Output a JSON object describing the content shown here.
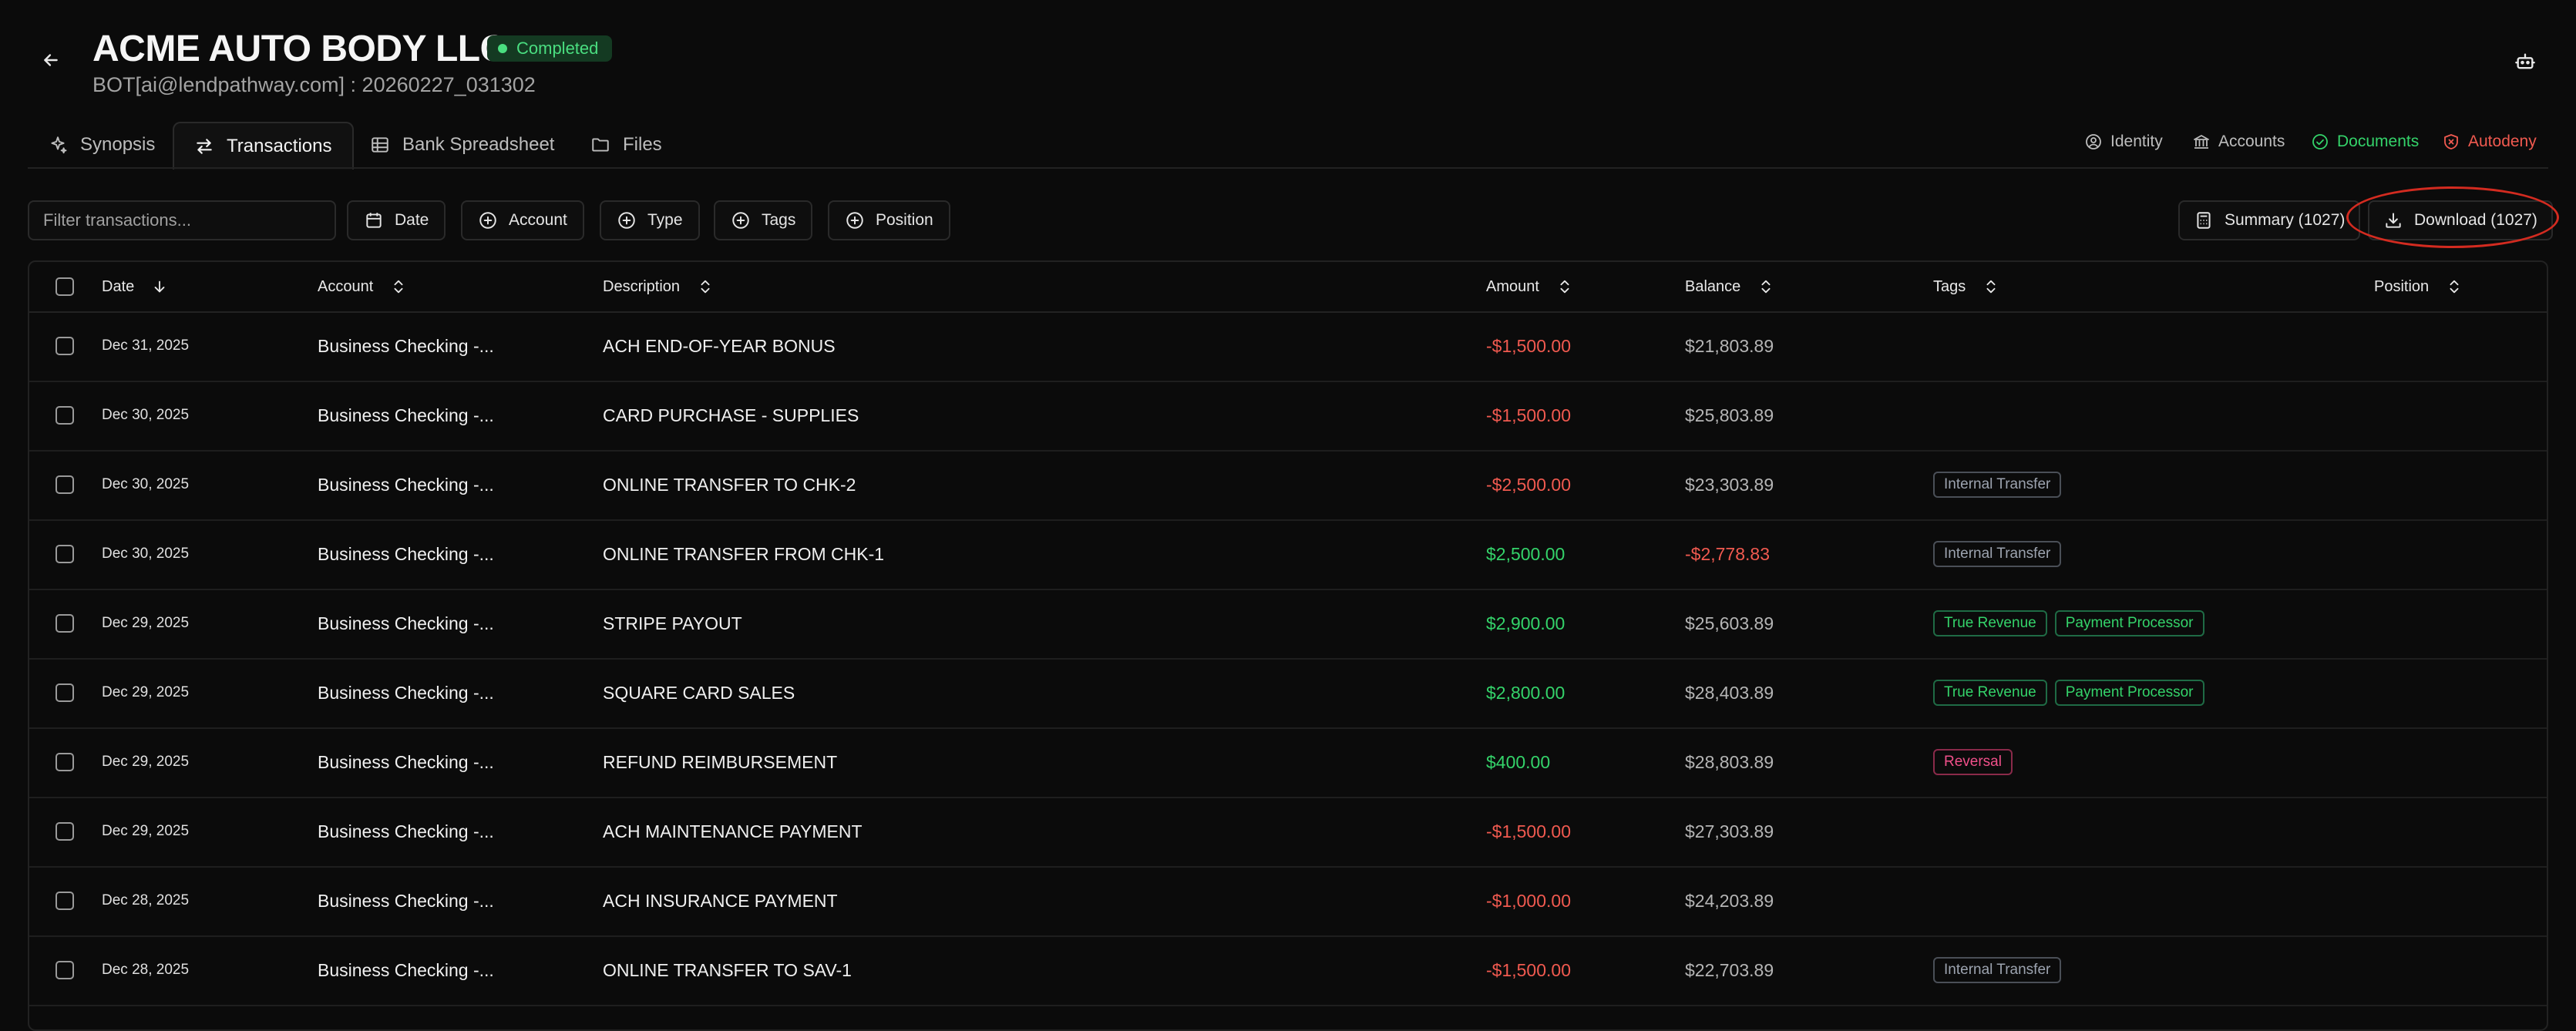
{
  "header": {
    "title": "ACME AUTO BODY LLC",
    "status": "Completed",
    "subtitle": "BOT[ai@lendpathway.com] : 20260227_031302"
  },
  "tabs": [
    {
      "label": "Synopsis",
      "icon": "sparkle-icon"
    },
    {
      "label": "Transactions",
      "icon": "arrows-swap-icon"
    },
    {
      "label": "Bank Spreadsheet",
      "icon": "grid-icon"
    },
    {
      "label": "Files",
      "icon": "folder-icon"
    }
  ],
  "status_items": [
    {
      "label": "Identity",
      "icon": "user-circle-icon",
      "color": "#bdbdbd"
    },
    {
      "label": "Accounts",
      "icon": "bank-icon",
      "color": "#bdbdbd"
    },
    {
      "label": "Documents",
      "icon": "check-circle-icon",
      "color": "#34d36a"
    },
    {
      "label": "Autodeny",
      "icon": "shield-x-icon",
      "color": "#f15a50"
    }
  ],
  "filters": {
    "search_placeholder": "Filter transactions...",
    "buttons": [
      "Date",
      "Account",
      "Type",
      "Tags",
      "Position"
    ],
    "summary_label": "Summary (1027)",
    "download_label": "Download (1027)"
  },
  "columns": [
    "Date",
    "Account",
    "Description",
    "Amount",
    "Balance",
    "Tags",
    "Position"
  ],
  "rows": [
    {
      "date": "Dec 31, 2025",
      "account": "Business Checking -...",
      "description": "ACH END-OF-YEAR BONUS",
      "amount": "-$1,500.00",
      "amount_sign": "neg",
      "balance": "$21,803.89",
      "balance_sign": "",
      "tags": []
    },
    {
      "date": "Dec 30, 2025",
      "account": "Business Checking -...",
      "description": "CARD PURCHASE - SUPPLIES",
      "amount": "-$1,500.00",
      "amount_sign": "neg",
      "balance": "$25,803.89",
      "balance_sign": "",
      "tags": []
    },
    {
      "date": "Dec 30, 2025",
      "account": "Business Checking -...",
      "description": "ONLINE TRANSFER TO CHK-2",
      "amount": "-$2,500.00",
      "amount_sign": "neg",
      "balance": "$23,303.89",
      "balance_sign": "",
      "tags": [
        {
          "label": "Internal Transfer",
          "kind": "internal"
        }
      ]
    },
    {
      "date": "Dec 30, 2025",
      "account": "Business Checking -...",
      "description": "ONLINE TRANSFER FROM CHK-1",
      "amount": "$2,500.00",
      "amount_sign": "pos",
      "balance": "-$2,778.83",
      "balance_sign": "neg",
      "tags": [
        {
          "label": "Internal Transfer",
          "kind": "internal"
        }
      ]
    },
    {
      "date": "Dec 29, 2025",
      "account": "Business Checking -...",
      "description": "STRIPE PAYOUT",
      "amount": "$2,900.00",
      "amount_sign": "pos",
      "balance": "$25,603.89",
      "balance_sign": "",
      "tags": [
        {
          "label": "True Revenue",
          "kind": "revenue"
        },
        {
          "label": "Payment Processor",
          "kind": "processor"
        }
      ]
    },
    {
      "date": "Dec 29, 2025",
      "account": "Business Checking -...",
      "description": "SQUARE CARD SALES",
      "amount": "$2,800.00",
      "amount_sign": "pos",
      "balance": "$28,403.89",
      "balance_sign": "",
      "tags": [
        {
          "label": "True Revenue",
          "kind": "revenue"
        },
        {
          "label": "Payment Processor",
          "kind": "processor"
        }
      ]
    },
    {
      "date": "Dec 29, 2025",
      "account": "Business Checking -...",
      "description": "REFUND REIMBURSEMENT",
      "amount": "$400.00",
      "amount_sign": "pos",
      "balance": "$28,803.89",
      "balance_sign": "",
      "tags": [
        {
          "label": "Reversal",
          "kind": "reversal"
        }
      ]
    },
    {
      "date": "Dec 29, 2025",
      "account": "Business Checking -...",
      "description": "ACH MAINTENANCE PAYMENT",
      "amount": "-$1,500.00",
      "amount_sign": "neg",
      "balance": "$27,303.89",
      "balance_sign": "",
      "tags": []
    },
    {
      "date": "Dec 28, 2025",
      "account": "Business Checking -...",
      "description": "ACH INSURANCE PAYMENT",
      "amount": "-$1,000.00",
      "amount_sign": "neg",
      "balance": "$24,203.89",
      "balance_sign": "",
      "tags": []
    },
    {
      "date": "Dec 28, 2025",
      "account": "Business Checking -...",
      "description": "ONLINE TRANSFER TO SAV-1",
      "amount": "-$1,500.00",
      "amount_sign": "neg",
      "balance": "$22,703.89",
      "balance_sign": "",
      "tags": [
        {
          "label": "Internal Transfer",
          "kind": "internal"
        }
      ]
    }
  ]
}
